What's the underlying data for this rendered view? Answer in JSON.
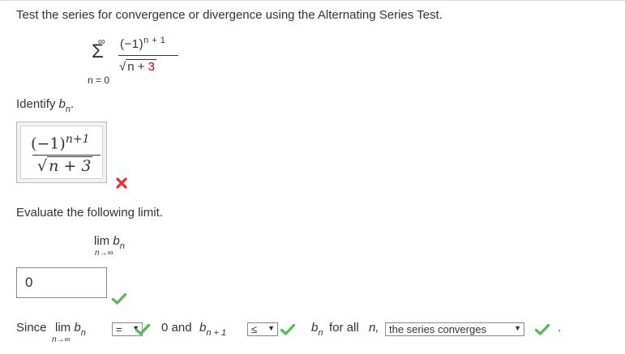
{
  "question": {
    "text": "Test the series for convergence or divergence using the Alternating Series Test."
  },
  "series": {
    "sum_upper": "∞",
    "sum_symbol": "Σ",
    "sum_lower": "n = 0",
    "numerator_base": "(−1)",
    "numerator_exp": "n + 1",
    "denominator_var": "n + ",
    "denominator_const": "3"
  },
  "identify": {
    "label_prefix": "Identify ",
    "label_var": "b",
    "label_sub": "n",
    "label_suffix": "."
  },
  "answer_bn": {
    "numerator_base": "(−1)",
    "numerator_exp": "n+1",
    "denominator": "n + 3",
    "status": "incorrect"
  },
  "evaluate": {
    "text": "Evaluate the following limit."
  },
  "limit_expr": {
    "lim": "lim",
    "var": "b",
    "sub": "n",
    "under": "n→∞"
  },
  "limit_input": {
    "value": "0",
    "status": "correct"
  },
  "since_row": {
    "since": "Since",
    "lim": "lim",
    "var": "b",
    "sub": "n",
    "under": "n→∞",
    "dropdown1_value": "=",
    "zero_and": "0 and",
    "b_var": "b",
    "b_sub": "n + 1",
    "dropdown2_value": "≤",
    "bn_var": "b",
    "bn_sub": "n",
    "for_all": "for all",
    "n_var": "n,",
    "dropdown3_value": "the series converges",
    "period": "."
  },
  "colors": {
    "check": "#5cb85c",
    "cross": "#e0312c",
    "text": "#333333",
    "accent_red": "#c00000"
  }
}
